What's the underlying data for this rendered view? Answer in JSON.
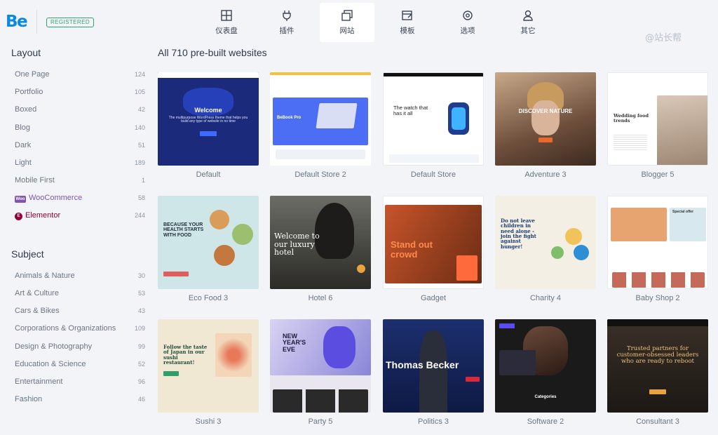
{
  "header": {
    "logo": "Be",
    "badge": "REGISTERED",
    "watermark": "@站长帮",
    "nav": [
      {
        "label": "仪表盘",
        "icon": "dashboard-icon",
        "active": false
      },
      {
        "label": "插件",
        "icon": "plug-icon",
        "active": false
      },
      {
        "label": "网站",
        "icon": "websites-icon",
        "active": true
      },
      {
        "label": "模板",
        "icon": "template-icon",
        "active": false
      },
      {
        "label": "选项",
        "icon": "gear-icon",
        "active": false
      },
      {
        "label": "其它",
        "icon": "user-icon",
        "active": false
      }
    ]
  },
  "sidebar": {
    "layout_title": "Layout",
    "layout": [
      {
        "label": "One Page",
        "count": "124"
      },
      {
        "label": "Portfolio",
        "count": "105"
      },
      {
        "label": "Boxed",
        "count": "42"
      },
      {
        "label": "Blog",
        "count": "140"
      },
      {
        "label": "Dark",
        "count": "51"
      },
      {
        "label": "Light",
        "count": "189"
      },
      {
        "label": "Mobile First",
        "count": "1"
      },
      {
        "label": "WooCommerce",
        "count": "58",
        "icon": "woocommerce-icon",
        "icon_text": "Woo"
      },
      {
        "label": "Elementor",
        "count": "244",
        "icon": "elementor-icon",
        "icon_text": "E"
      }
    ],
    "subject_title": "Subject",
    "subject": [
      {
        "label": "Animals & Nature",
        "count": "30"
      },
      {
        "label": "Art & Culture",
        "count": "53"
      },
      {
        "label": "Cars & Bikes",
        "count": "43"
      },
      {
        "label": "Corporations & Organizations",
        "count": "109"
      },
      {
        "label": "Design & Photography",
        "count": "99"
      },
      {
        "label": "Education & Science",
        "count": "52"
      },
      {
        "label": "Entertainment",
        "count": "96"
      },
      {
        "label": "Fashion",
        "count": "46"
      }
    ]
  },
  "main": {
    "title": "All 710 pre-built websites",
    "templates": [
      {
        "name": "Default",
        "thumb_bg": "#1b2a7a",
        "thumb_accent": "#3d6bff",
        "headline": "Welcome",
        "headline_color": "#ffffff",
        "subtext": "The multipurpose WordPress theme that helps you build any type of website in no time"
      },
      {
        "name": "Default Store 2",
        "thumb_bg": "#ffffff",
        "thumb_accent": "#4c6ef5",
        "headline": "BeBook Pro",
        "headline_color": "#ffffff",
        "subtext": ""
      },
      {
        "name": "Default Store",
        "thumb_bg": "#ffffff",
        "thumb_accent": "#2c7be5",
        "headline": "The watch that has it all",
        "headline_color": "#222222",
        "subtext": ""
      },
      {
        "name": "Adventure 3",
        "thumb_bg": "#8a6a52",
        "thumb_accent": "#e8692d",
        "headline": "DISCOVER NATURE",
        "headline_color": "#ffffff",
        "subtext": ""
      },
      {
        "name": "Blogger 5",
        "thumb_bg": "#ffffff",
        "thumb_accent": "#c9b8a6",
        "headline": "Wedding food trends",
        "headline_color": "#333333",
        "subtext": ""
      },
      {
        "name": "Eco Food 3",
        "thumb_bg": "#cfe6e8",
        "thumb_accent": "#e05d5d",
        "headline": "BECAUSE YOUR HEALTH STARTS WITH FOOD",
        "headline_color": "#1f2d3a",
        "subtext": ""
      },
      {
        "name": "Hotel 6",
        "thumb_bg": "#3b3a35",
        "thumb_accent": "#e8a33d",
        "headline": "Welcome to our luxury hotel",
        "headline_color": "#ffffff",
        "subtext": ""
      },
      {
        "name": "Gadget",
        "thumb_bg": "#c7542a",
        "thumb_accent": "#ff6a3d",
        "headline": "Stand out crowd",
        "headline_color": "#ffffff",
        "subtext": ""
      },
      {
        "name": "Charity 4",
        "thumb_bg": "#f3efe4",
        "thumb_accent": "#2d8fd5",
        "headline": "Do not leave children in need alone - join the fight against hunger!",
        "headline_color": "#1c3b73",
        "subtext": ""
      },
      {
        "name": "Baby Shop 2",
        "thumb_bg": "#ffffff",
        "thumb_accent": "#e8a470",
        "headline": "Special offer",
        "headline_color": "#333333",
        "subtext": ""
      },
      {
        "name": "Sushi 3",
        "thumb_bg": "#f1e8d4",
        "thumb_accent": "#2f9e6b",
        "headline": "Follow the taste of Japan in our sushi restaurant!",
        "headline_color": "#1e4d3a",
        "subtext": ""
      },
      {
        "name": "Party 5",
        "thumb_bg": "#e9e6ef",
        "thumb_accent": "#5b4de0",
        "headline": "NEW YEAR'S EVE",
        "headline_color": "#1c1c3a",
        "subtext": ""
      },
      {
        "name": "Politics 3",
        "thumb_bg": "#1c2f6e",
        "thumb_accent": "#d8293b",
        "headline": "Thomas Becker",
        "headline_color": "#ffffff",
        "subtext": ""
      },
      {
        "name": "Software 2",
        "thumb_bg": "#1a1a1a",
        "thumb_accent": "#5a4cf2",
        "headline": "Categories",
        "headline_color": "#ffffff",
        "subtext": ""
      },
      {
        "name": "Consultant 3",
        "thumb_bg": "#2a2420",
        "thumb_accent": "#e8a33d",
        "headline": "Trusted partners for customer-obsessed leaders who are ready to reboot",
        "headline_color": "#f1c27d",
        "subtext": ""
      }
    ]
  }
}
